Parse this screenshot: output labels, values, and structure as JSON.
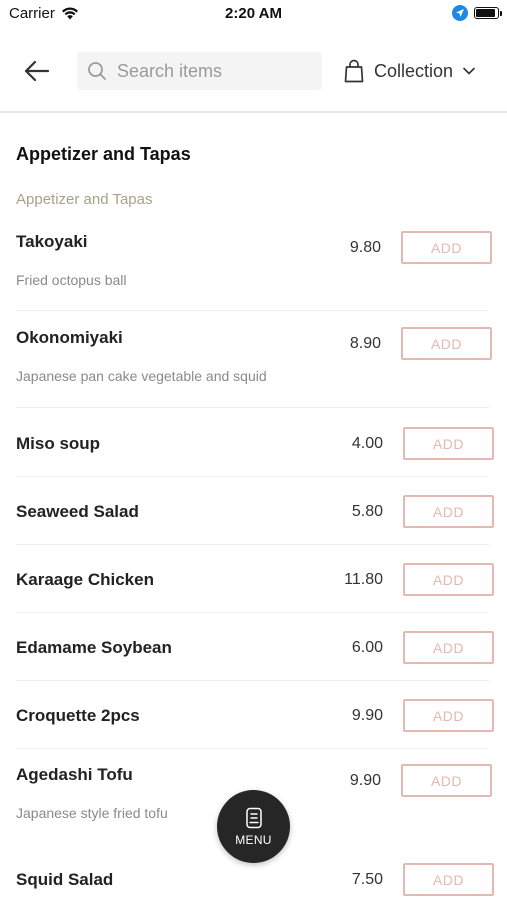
{
  "status": {
    "carrier": "Carrier",
    "time": "2:20 AM"
  },
  "header": {
    "search_placeholder": "Search items",
    "collection_label": "Collection"
  },
  "section_title": "Appetizer and Tapas",
  "category_label": "Appetizer and Tapas",
  "add_label": "ADD",
  "items": [
    {
      "name": "Takoyaki",
      "price": "9.80",
      "desc": "Fried octopus ball"
    },
    {
      "name": "Okonomiyaki",
      "price": "8.90",
      "desc": "Japanese pan cake vegetable and squid"
    },
    {
      "name": "Miso soup",
      "price": "4.00",
      "desc": ""
    },
    {
      "name": "Seaweed Salad",
      "price": "5.80",
      "desc": ""
    },
    {
      "name": "Karaage Chicken",
      "price": "11.80",
      "desc": ""
    },
    {
      "name": "Edamame Soybean",
      "price": "6.00",
      "desc": ""
    },
    {
      "name": "Croquette 2pcs",
      "price": "9.90",
      "desc": ""
    },
    {
      "name": "Agedashi Tofu",
      "price": "9.90",
      "desc": "Japanese style fried tofu"
    },
    {
      "name": "Squid Salad",
      "price": "7.50",
      "desc": ""
    }
  ],
  "menu": {
    "label": "MENU"
  }
}
